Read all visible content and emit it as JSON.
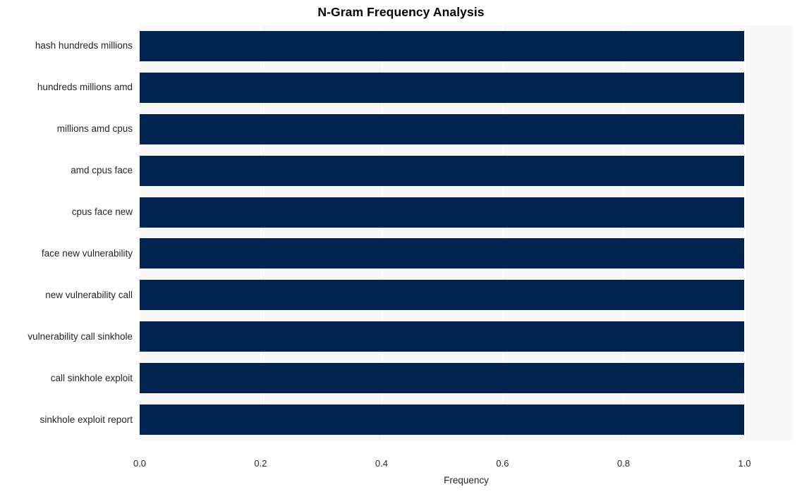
{
  "chart_data": {
    "type": "bar",
    "orientation": "horizontal",
    "title": "N-Gram Frequency Analysis",
    "xlabel": "Frequency",
    "ylabel": "",
    "categories": [
      "hash hundreds millions",
      "hundreds millions amd",
      "millions amd cpus",
      "amd cpus face",
      "cpus face new",
      "face new vulnerability",
      "new vulnerability call",
      "vulnerability call sinkhole",
      "call sinkhole exploit",
      "sinkhole exploit report"
    ],
    "values": [
      1.0,
      1.0,
      1.0,
      1.0,
      1.0,
      1.0,
      1.0,
      1.0,
      1.0,
      1.0
    ],
    "xlim": [
      0.0,
      1.08
    ],
    "xticks": [
      0.0,
      0.2,
      0.4,
      0.6,
      0.8,
      1.0
    ],
    "xtick_labels": [
      "0.0",
      "0.2",
      "0.4",
      "0.6",
      "0.8",
      "1.0"
    ],
    "grid": "vertical",
    "legend": null,
    "colors": {
      "bar": "#002350",
      "plot_background": "#f7f7f7",
      "figure_background": "#ffffff",
      "gridline": "#ffffff",
      "tick_text": "#262626",
      "title_text": "#000000"
    }
  }
}
